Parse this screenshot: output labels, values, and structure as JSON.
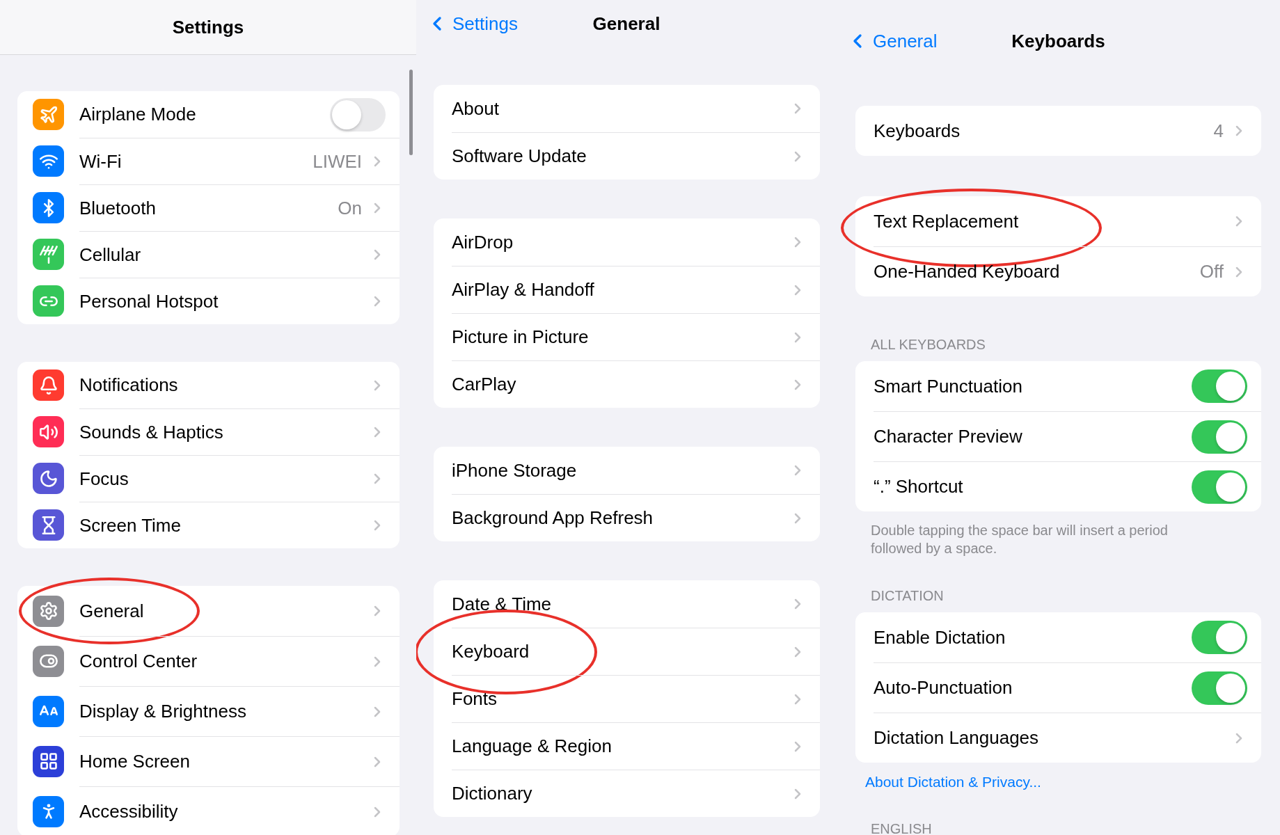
{
  "settings_panel": {
    "title": "Settings",
    "groups": [
      {
        "rows": [
          {
            "kind": "toggle",
            "label": "Airplane Mode",
            "on": false,
            "color": "#ff9500",
            "circled": false
          },
          {
            "kind": "link",
            "label": "Wi-Fi",
            "value": "LIWEI",
            "color": "#007aff",
            "circled": false
          },
          {
            "kind": "link",
            "label": "Bluetooth",
            "value": "On",
            "color": "#007aff",
            "circled": false
          },
          {
            "kind": "link",
            "label": "Cellular",
            "color": "#34c759",
            "circled": false
          },
          {
            "kind": "link",
            "label": "Personal Hotspot",
            "color": "#34c759",
            "circled": false
          }
        ]
      },
      {
        "rows": [
          {
            "kind": "link",
            "label": "Notifications",
            "color": "#ff3b30",
            "circled": false
          },
          {
            "kind": "link",
            "label": "Sounds & Haptics",
            "color": "#ff2d55",
            "circled": false
          },
          {
            "kind": "link",
            "label": "Focus",
            "color": "#5856d6",
            "circled": false
          },
          {
            "kind": "link",
            "label": "Screen Time",
            "color": "#5856d6",
            "circled": false
          }
        ]
      },
      {
        "rows": [
          {
            "kind": "link",
            "label": "General",
            "color": "#8e8e93",
            "circled": true
          },
          {
            "kind": "link",
            "label": "Control Center",
            "color": "#8e8e93",
            "circled": false
          },
          {
            "kind": "link",
            "label": "Display & Brightness",
            "color": "#007aff",
            "circled": false
          },
          {
            "kind": "link",
            "label": "Home Screen",
            "color": "#2c3fd8",
            "circled": false
          },
          {
            "kind": "link",
            "label": "Accessibility",
            "color": "#007aff",
            "circled": false
          }
        ]
      }
    ]
  },
  "general_panel": {
    "back": "Settings",
    "title": "General",
    "groups": [
      {
        "rows": [
          {
            "label": "About",
            "circled": false
          },
          {
            "label": "Software Update",
            "circled": false
          }
        ]
      },
      {
        "rows": [
          {
            "label": "AirDrop",
            "circled": false
          },
          {
            "label": "AirPlay & Handoff",
            "circled": false
          },
          {
            "label": "Picture in Picture",
            "circled": false
          },
          {
            "label": "CarPlay",
            "circled": false
          }
        ]
      },
      {
        "rows": [
          {
            "label": "iPhone Storage",
            "circled": false
          },
          {
            "label": "Background App Refresh",
            "circled": false
          }
        ]
      },
      {
        "rows": [
          {
            "label": "Date & Time",
            "circled": false
          },
          {
            "label": "Keyboard",
            "circled": true
          },
          {
            "label": "Fonts",
            "circled": false
          },
          {
            "label": "Language & Region",
            "circled": false
          },
          {
            "label": "Dictionary",
            "circled": false
          }
        ]
      }
    ]
  },
  "keyboards_panel": {
    "back": "General",
    "title": "Keyboards",
    "sections": [
      {
        "rows": [
          {
            "kind": "link",
            "label": "Keyboards",
            "value": "4",
            "circled": false
          }
        ]
      },
      {
        "rows": [
          {
            "kind": "link",
            "label": "Text Replacement",
            "circled": true
          },
          {
            "kind": "link",
            "label": "One-Handed Keyboard",
            "value": "Off",
            "circled": false
          }
        ]
      },
      {
        "header": "ALL KEYBOARDS",
        "rows": [
          {
            "kind": "toggle",
            "label": "Smart Punctuation",
            "on": true,
            "circled": false
          },
          {
            "kind": "toggle",
            "label": "Character Preview",
            "on": true,
            "circled": false
          },
          {
            "kind": "toggle",
            "label": "“.” Shortcut",
            "on": true,
            "circled": false
          }
        ],
        "footer": "Double tapping the space bar will insert a period followed by a space."
      },
      {
        "header": "DICTATION",
        "rows": [
          {
            "kind": "toggle",
            "label": "Enable Dictation",
            "on": true,
            "circled": false
          },
          {
            "kind": "toggle",
            "label": "Auto-Punctuation",
            "on": true,
            "circled": false
          },
          {
            "kind": "link",
            "label": "Dictation Languages",
            "circled": false
          }
        ],
        "link": "About Dictation & Privacy..."
      },
      {
        "header": "ENGLISH"
      }
    ]
  }
}
